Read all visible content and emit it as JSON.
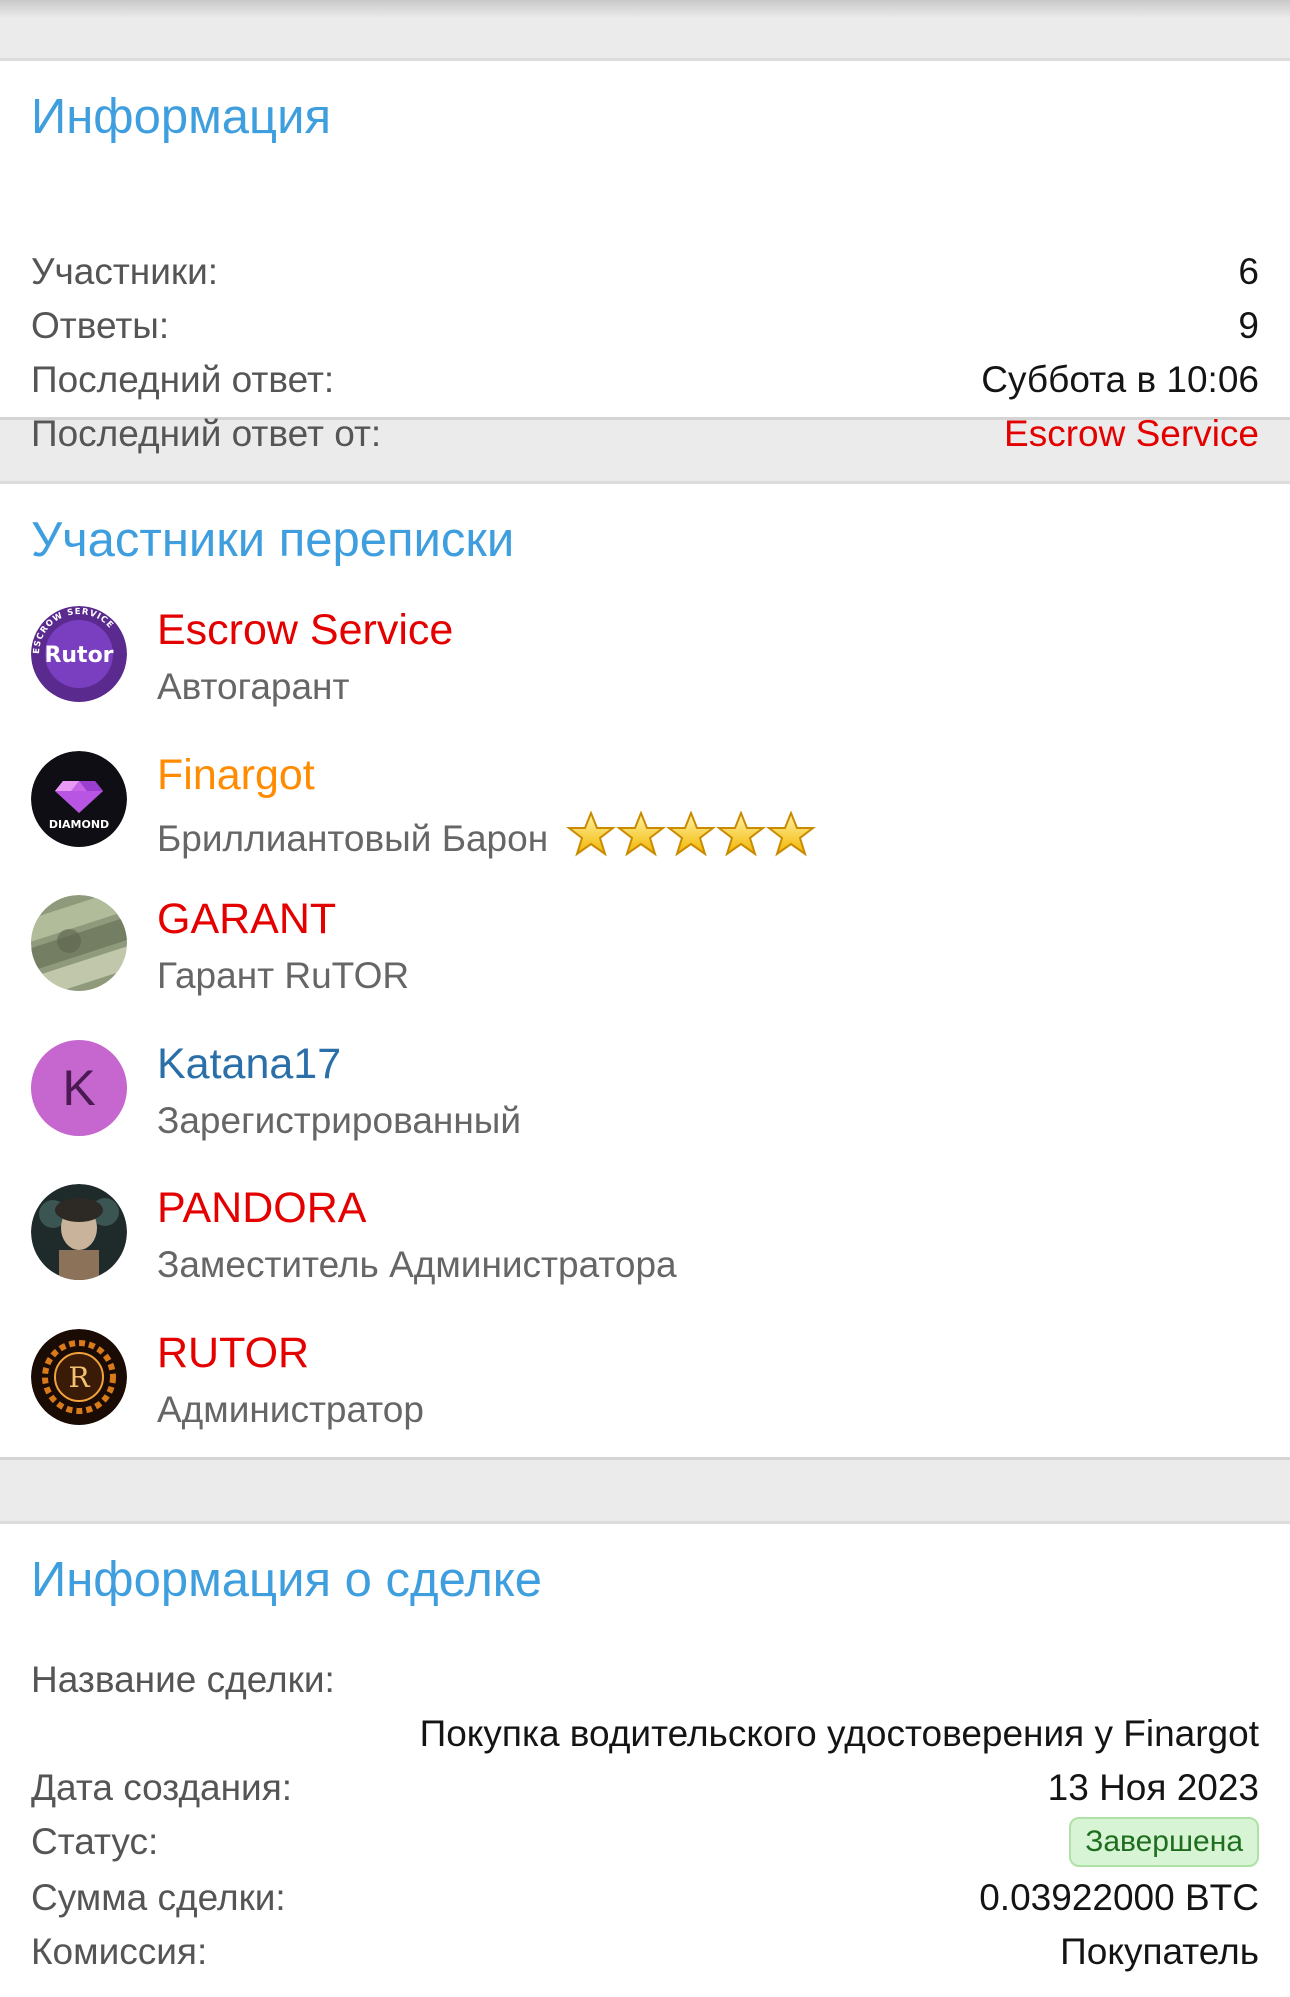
{
  "info": {
    "title": "Информация",
    "rows": [
      {
        "label": "Участники:",
        "value": "6"
      },
      {
        "label": "Ответы:",
        "value": "9"
      },
      {
        "label": "Последний ответ:",
        "value": "Суббота в 10:06"
      },
      {
        "label": "Последний ответ от:",
        "value": "Escrow Service"
      }
    ]
  },
  "members": {
    "title": "Участники переписки",
    "items": [
      {
        "name": "Escrow Service",
        "role": "Автогарант",
        "name_color": "#e50000",
        "avatar_text": "Rutor",
        "avatar_ring_text": "ESCROW SERVICE"
      },
      {
        "name": "Finargot",
        "role": "Бриллиантовый Барон",
        "name_color": "#ff8c00",
        "avatar_text": "DIAMOND",
        "stars": 5
      },
      {
        "name": "GARANT",
        "role": "Гарант RuTOR",
        "name_color": "#e50000"
      },
      {
        "name": "Katana17",
        "role": "Зарегистрированный",
        "name_color": "#2a6fa8",
        "avatar_text": "K",
        "avatar_color": "#c667cf"
      },
      {
        "name": "PANDORA",
        "role": "Заместитель Администратора",
        "name_color": "#e50000"
      },
      {
        "name": "RUTOR",
        "role": "Администратор",
        "name_color": "#e50000",
        "avatar_text": "R"
      }
    ]
  },
  "deal": {
    "title": "Информация о сделке",
    "name_label": "Название сделки:",
    "name_value": "Покупка водительского удостоверения у Finargot",
    "rows": [
      {
        "label": "Дата создания:",
        "value": "13 Ноя 2023"
      },
      {
        "label": "Статус:",
        "value": "Завершена"
      },
      {
        "label": "Сумма сделки:",
        "value": "0.03922000 BTC"
      },
      {
        "label": "Комиссия:",
        "value": "Покупатель"
      }
    ]
  },
  "colors": {
    "accent_title": "#3f9fde",
    "red_name": "#e50000",
    "status_green_bg": "#d7f5d4"
  }
}
